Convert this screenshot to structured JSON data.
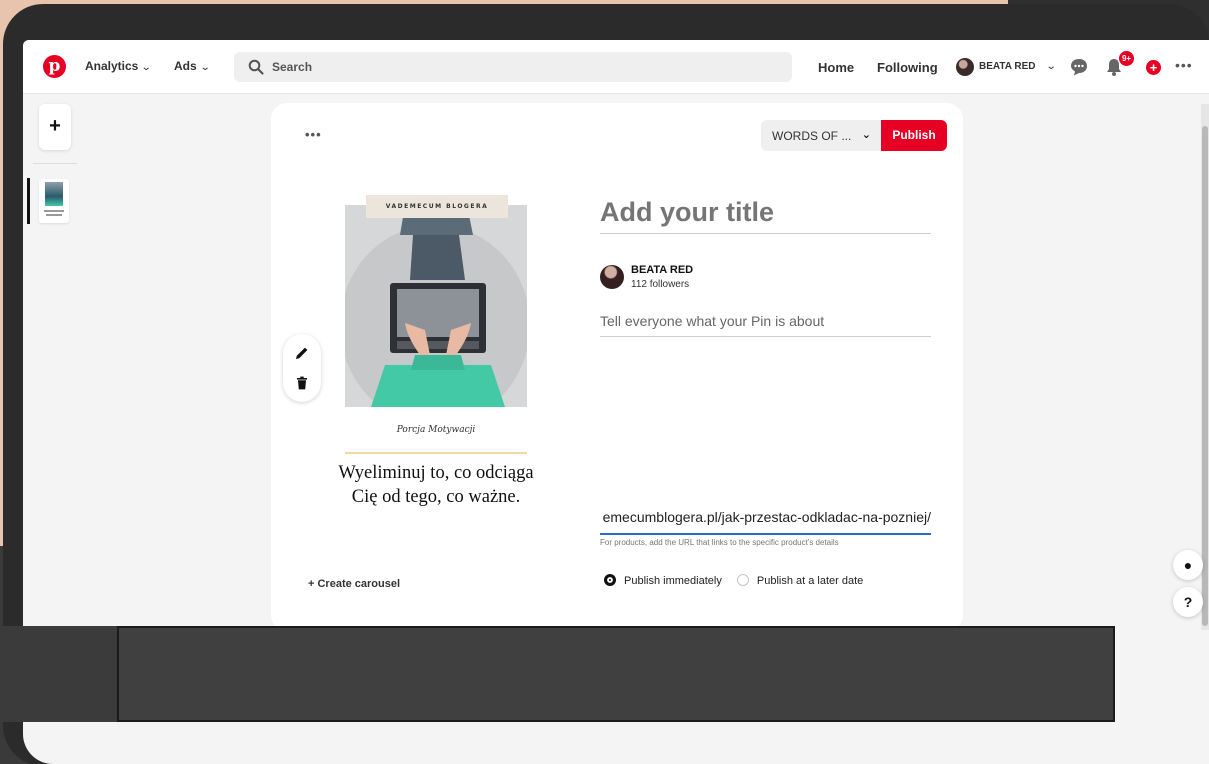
{
  "nav": {
    "menus": [
      {
        "label": "Analytics"
      },
      {
        "label": "Ads"
      }
    ],
    "search_placeholder": "Search",
    "links": {
      "home": "Home",
      "following": "Following"
    },
    "user": {
      "name": "BEATA RED"
    },
    "notifications_badge": "9+"
  },
  "editor": {
    "board_select_label": "WORDS OF ...",
    "publish_label": "Publish",
    "create_carousel_label": "+ Create carousel",
    "title_placeholder": "Add your title",
    "author": {
      "name": "BEATA RED",
      "followers": "112 followers"
    },
    "description_placeholder": "Tell everyone what your Pin is about",
    "destination_url": "emecumblogera.pl/jak-przestac-odkladac-na-pozniej/",
    "url_hint": "For products, add the URL that links to the specific product's details",
    "publish_options": [
      {
        "label": "Publish immediately",
        "selected": true
      },
      {
        "label": "Publish at a later date",
        "selected": false
      }
    ]
  },
  "pin": {
    "brand": "VADEMECUM BLOGERA",
    "caption": "Porcja Motywacji",
    "quote": "Wyeliminuj to, co odciąga Cię od tego, co ważne."
  },
  "colors": {
    "brand_red": "#e60023",
    "url_underline": "#2a6acb"
  }
}
